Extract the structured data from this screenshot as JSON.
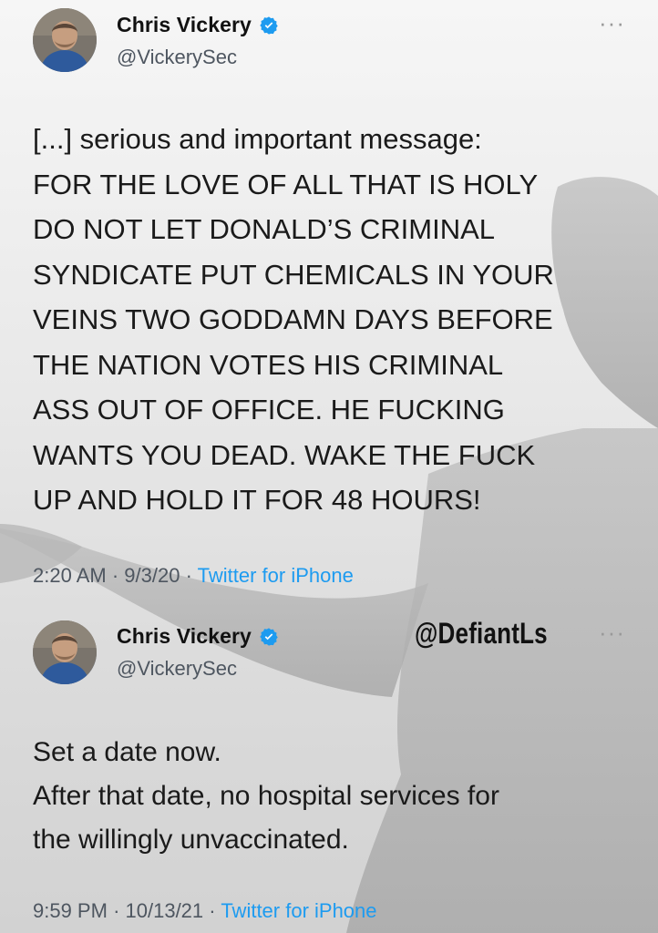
{
  "tweets": [
    {
      "author": {
        "name": "Chris Vickery",
        "handle": "@VickerySec",
        "verified": true
      },
      "text": "[...] serious and important message:\nFOR THE LOVE OF ALL THAT IS HOLY\nDO NOT LET DONALD’S CRIMINAL\nSYNDICATE PUT CHEMICALS IN YOUR\nVEINS TWO GODDAMN DAYS BEFORE\nTHE NATION VOTES HIS CRIMINAL\nASS OUT OF OFFICE. HE FUCKING\nWANTS YOU DEAD. WAKE THE FUCK\nUP AND HOLD IT FOR 48 HOURS!",
      "time": "2:20 AM",
      "date": "9/3/20",
      "sep": "·",
      "source": "Twitter for iPhone",
      "more": "···"
    },
    {
      "author": {
        "name": "Chris Vickery",
        "handle": "@VickerySec",
        "verified": true
      },
      "text": "Set a date now.\nAfter that date, no hospital services for\nthe willingly unvaccinated.",
      "time": "9:59 PM",
      "date": "10/13/21",
      "sep": "·",
      "source": "Twitter for iPhone",
      "more": "···"
    }
  ],
  "watermark": "@DefiantLs",
  "colors": {
    "link": "#1d9bf0",
    "verified": "#1d9bf0",
    "secondary_text": "#4e5660"
  },
  "icons": [
    "verified-badge-icon",
    "more-options-icon",
    "avatar"
  ]
}
